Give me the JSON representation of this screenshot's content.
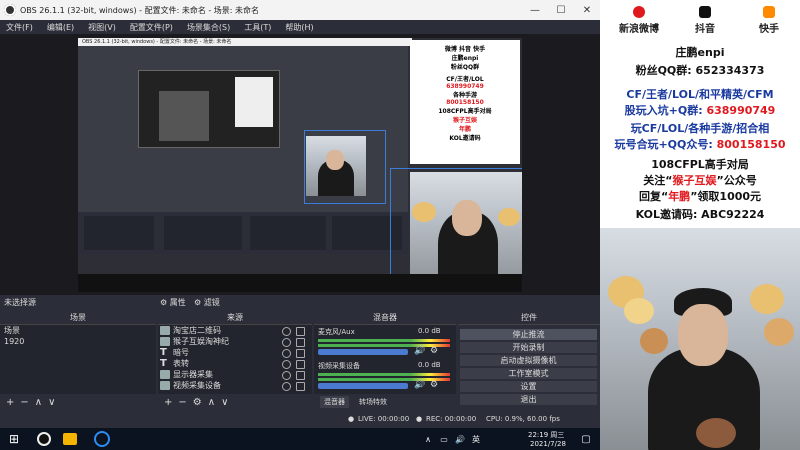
{
  "window": {
    "title": "OBS 26.1.1 (32-bit, windows) - 配置文件: 未命名 - 场景: 未命名"
  },
  "menu": [
    "文件(F)",
    "编辑(E)",
    "视图(V)",
    "配置文件(P)",
    "场景集合(S)",
    "工具(T)",
    "帮助(H)"
  ],
  "preview": {
    "nested_title": "OBS 26.1.1 (32-bit, windows) - 配置文件: 未命名 - 场景: 未命名"
  },
  "dock": {
    "no_source": "未选择源",
    "props_tab": "属性",
    "filters_tab": "滤镜",
    "scenes_header": "场景",
    "sources_header": "来源",
    "mixer_header": "混音器",
    "controls_header": "控件",
    "scenes": [
      "场景",
      "1920"
    ],
    "sources": [
      "淘宝店二维码",
      "猴子互娱淘神纪",
      "暗号",
      "表转",
      "显示器采集",
      "视频采集设备"
    ],
    "mixer": {
      "ch1_name": "麦克风/Aux",
      "ch1_db": "0.0 dB",
      "ch2_name": "视频采集设备",
      "ch2_db": "0.0 dB",
      "mixer_tab": "混音器",
      "transition_tab": "转场特效"
    },
    "controls": [
      "停止推流",
      "开始录制",
      "启动虚拟摄像机",
      "工作室模式",
      "设置",
      "退出"
    ]
  },
  "status": {
    "live": "LIVE: 00:00:00",
    "rec": "REC: 00:00:00",
    "cpu": "CPU: 0.9%, 60.00 fps"
  },
  "taskbar": {
    "time": "22:19 周三",
    "date": "2021/7/28"
  },
  "poster": {
    "weibo": "新浪微博",
    "douyin": "抖音",
    "kuaishou": "快手",
    "name": "庄鹏enpi",
    "fans_qq": "粉丝QQ群: 652334373",
    "line1": "CF/王者/LOL/和平精英/CFM",
    "line2_label": "股玩入坑+Q群: ",
    "line2_num": "638990749",
    "line3": "玩CF/LOL/各种手游/招合相",
    "line4_label": "玩号合玩+QQ众号: ",
    "line4_num": "800158150",
    "line5": "108CFPL高手对局",
    "line6_a": "关注“",
    "line6_b": "猴子互娱",
    "line6_c": "”公众号",
    "line7_a": "回复“",
    "line7_b": "年鹏",
    "line7_c": "”领取1000元",
    "line8": "KOL邀请码: ABC92224"
  },
  "colors": {
    "obs_bg": "#2b2e38",
    "accent_blue": "#3b7bd9",
    "poster_red": "#e0191f"
  }
}
